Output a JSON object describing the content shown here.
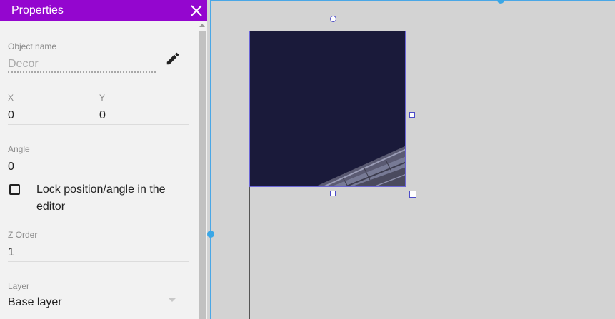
{
  "panel": {
    "title": "Properties",
    "close_icon": "close-icon",
    "header_color": "#9406cf"
  },
  "object_name": {
    "label": "Object name",
    "placeholder": "Decor",
    "edit_icon": "pencil-icon"
  },
  "position": {
    "x_label": "X",
    "x_value": "0",
    "y_label": "Y",
    "y_value": "0"
  },
  "angle": {
    "label": "Angle",
    "value": "0"
  },
  "lock": {
    "label": "Lock position/angle in the editor",
    "checked": false
  },
  "z_order": {
    "label": "Z Order",
    "value": "1"
  },
  "layer": {
    "label": "Layer",
    "value": "Base layer",
    "dropdown_icon": "chevron-down-icon"
  },
  "editor": {
    "selection_color": "#4c4cc8",
    "viewport_border_color": "#4aa7e6",
    "canvas_color": "#d3d3d3",
    "sprite_color": "#1a1a3a"
  }
}
